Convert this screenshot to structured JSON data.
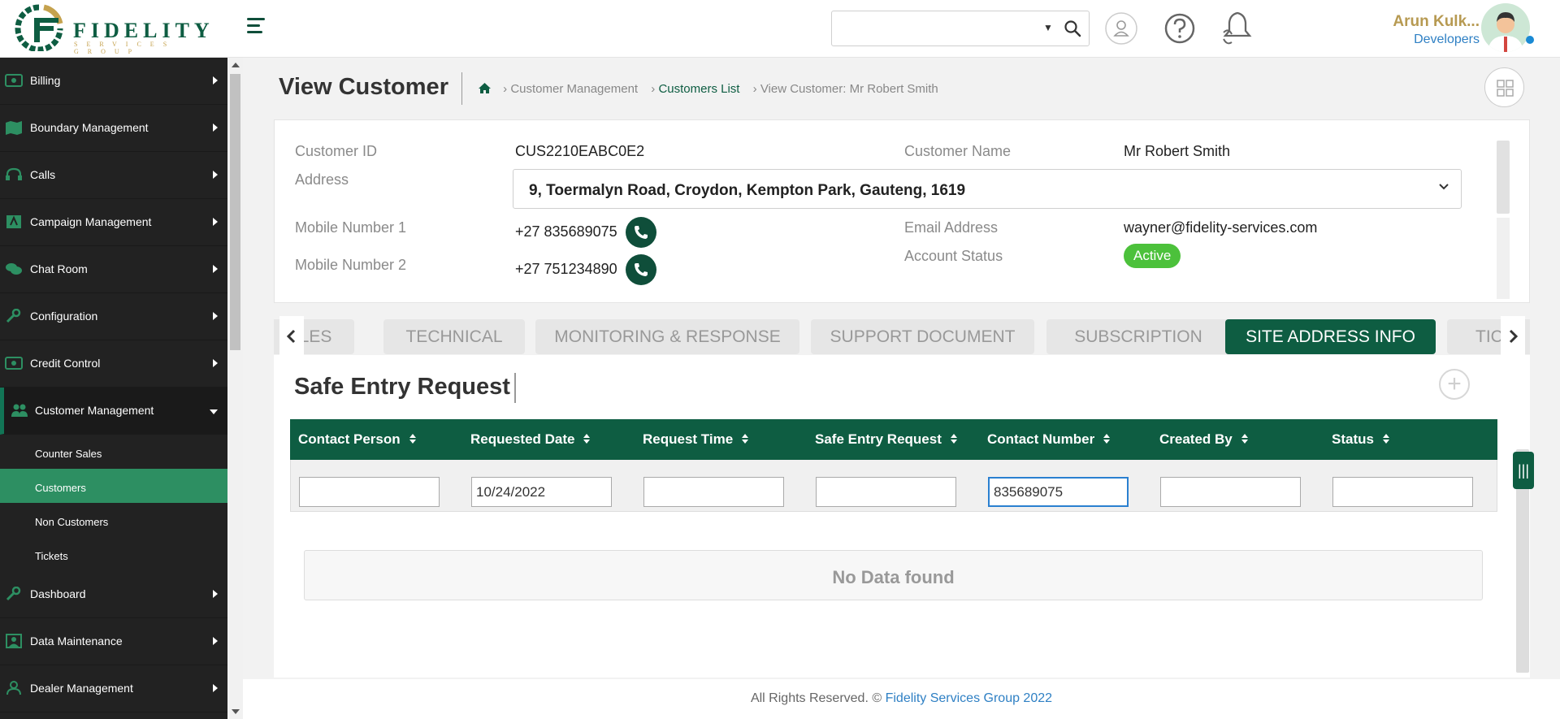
{
  "brand": {
    "name": "FIDELITY",
    "tagline": "SERVICES GROUP"
  },
  "header": {
    "user_name": "Arun Kulk...",
    "user_role": "Developers",
    "search_value": ""
  },
  "sidebar": {
    "items_top": [
      {
        "label": "Billing",
        "icon": "money-icon"
      },
      {
        "label": "Boundary Management",
        "icon": "map-icon"
      },
      {
        "label": "Calls",
        "icon": "headset-icon"
      },
      {
        "label": "Campaign Management",
        "icon": "campaign-icon"
      },
      {
        "label": "Chat Room",
        "icon": "chat-icon"
      },
      {
        "label": "Configuration",
        "icon": "wrench-icon"
      },
      {
        "label": "Credit Control",
        "icon": "money-icon"
      }
    ],
    "open_item": {
      "label": "Customer Management",
      "icon": "users-icon"
    },
    "sub_items": [
      {
        "label": "Counter Sales"
      },
      {
        "label": "Customers"
      },
      {
        "label": "Non Customers"
      },
      {
        "label": "Tickets"
      }
    ],
    "items_bottom": [
      {
        "label": "Dashboard",
        "icon": "wrench-icon"
      },
      {
        "label": "Data Maintenance",
        "icon": "person-box-icon"
      },
      {
        "label": "Dealer Management",
        "icon": "user-icon"
      }
    ]
  },
  "page": {
    "title": "View Customer",
    "breadcrumb": [
      "Customer Management",
      "Customers List",
      "View Customer: Mr Robert Smith"
    ]
  },
  "customer": {
    "id_label": "Customer ID",
    "id_value": "CUS2210EABC0E2",
    "name_label": "Customer Name",
    "name_value": "Mr Robert Smith",
    "address_label": "Address",
    "address_value": "9, Toermalyn Road, Croydon, Kempton Park, Gauteng, 1619",
    "mobile1_label": "Mobile Number 1",
    "mobile1_value": "+27 835689075",
    "mobile2_label": "Mobile Number 2",
    "mobile2_value": "+27 751234890",
    "email_label": "Email Address",
    "email_value": "wayner@fidelity-services.com",
    "status_label": "Account Status",
    "status_value": "Active"
  },
  "tabs": [
    "ALES",
    "TECHNICAL",
    "MONITORING & RESPONSE",
    "SUPPORT DOCUMENT",
    "SUBSCRIPTION",
    "SITE ADDRESS INFO",
    "TIC"
  ],
  "section": {
    "title": "Safe Entry Request",
    "columns": [
      "Contact Person",
      "Requested Date",
      "Request Time",
      "Safe Entry Request",
      "Contact Number",
      "Created By",
      "Status"
    ],
    "filters": [
      "",
      "10/24/2022",
      "",
      "",
      "835689075",
      "",
      ""
    ],
    "empty_message": "No Data found"
  },
  "footer": {
    "text": "All Rights Reserved. ©",
    "company": "Fidelity Services Group 2022"
  },
  "colors": {
    "primary": "#0e5d42",
    "active_badge": "#4cc13b",
    "sidebar_bg": "#222222",
    "sub_active": "#2d8f62",
    "gold": "#b79a52"
  }
}
